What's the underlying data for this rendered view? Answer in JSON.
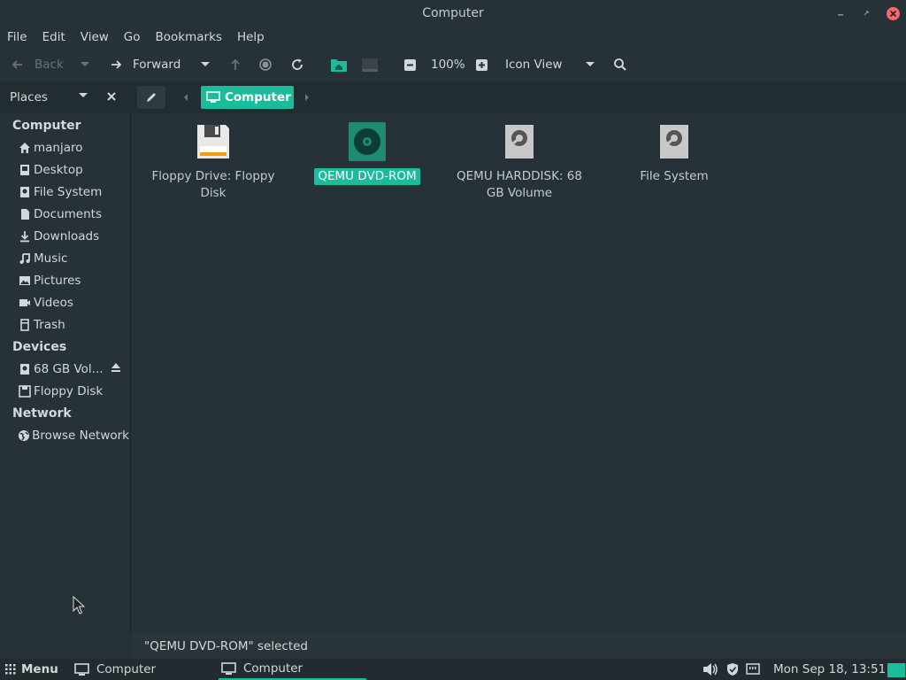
{
  "window": {
    "title": "Computer"
  },
  "menubar": {
    "items": [
      "File",
      "Edit",
      "View",
      "Go",
      "Bookmarks",
      "Help"
    ]
  },
  "toolbar": {
    "back_label": "Back",
    "forward_label": "Forward",
    "zoom_level": "100%",
    "view_mode": "Icon View"
  },
  "places": {
    "title": "Places"
  },
  "breadcrumb": {
    "current": "Computer"
  },
  "sidebar": {
    "headings": {
      "computer": "Computer",
      "devices": "Devices",
      "network": "Network"
    },
    "computer_items": [
      {
        "label": "manjaro",
        "icon": "home-icon"
      },
      {
        "label": "Desktop",
        "icon": "desktop-icon"
      },
      {
        "label": "File System",
        "icon": "drive-icon"
      },
      {
        "label": "Documents",
        "icon": "document-icon"
      },
      {
        "label": "Downloads",
        "icon": "download-icon"
      },
      {
        "label": "Music",
        "icon": "music-icon"
      },
      {
        "label": "Pictures",
        "icon": "picture-icon"
      },
      {
        "label": "Videos",
        "icon": "video-icon"
      },
      {
        "label": "Trash",
        "icon": "trash-icon"
      }
    ],
    "device_items": [
      {
        "label": "68 GB Vol...",
        "icon": "drive-icon"
      },
      {
        "label": "Floppy Disk",
        "icon": "floppy-icon"
      }
    ],
    "network_items": [
      {
        "label": "Browse Network",
        "icon": "network-icon"
      }
    ]
  },
  "files": [
    {
      "name": "Floppy Drive: Floppy Disk",
      "icon": "floppy-drive-icon",
      "selected": false
    },
    {
      "name": "QEMU DVD-ROM",
      "icon": "dvd-icon",
      "selected": true
    },
    {
      "name": "QEMU HARDDISK: 68 GB Volume",
      "icon": "harddisk-icon",
      "selected": false
    },
    {
      "name": "File System",
      "icon": "harddisk-icon",
      "selected": false
    }
  ],
  "statusbar": {
    "text": "\"QEMU DVD-ROM\" selected"
  },
  "taskbar": {
    "menu_label": "Menu",
    "tasks": [
      "Computer",
      "Computer"
    ],
    "clock": "Mon Sep 18, 13:51"
  },
  "colors": {
    "accent": "#1abc9c",
    "background": "#263238",
    "close_button": "#f06a6a"
  }
}
